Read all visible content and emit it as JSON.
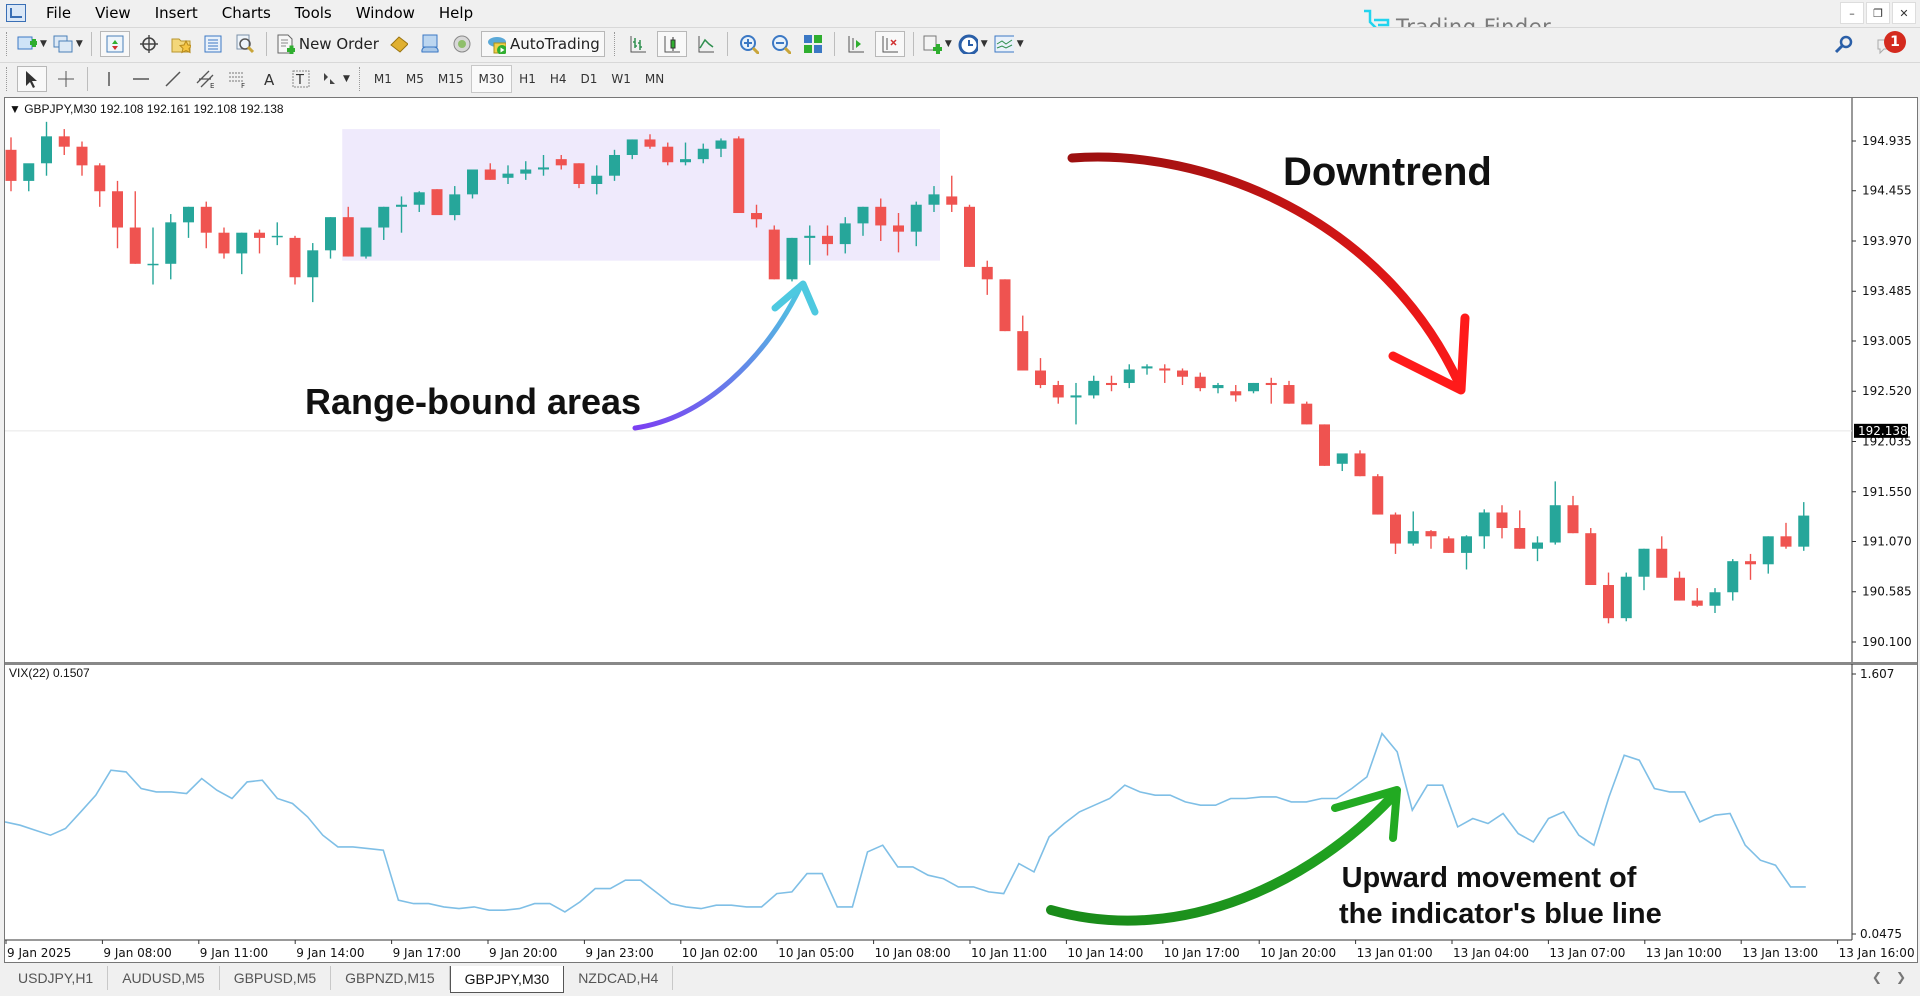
{
  "menu": [
    "File",
    "View",
    "Insert",
    "Charts",
    "Tools",
    "Window",
    "Help"
  ],
  "window_controls": {
    "minimize": "–",
    "restore": "❐",
    "close": "✕"
  },
  "brand": {
    "name": "Trading Finder",
    "color": "#1ec8e8"
  },
  "toolbar": {
    "new_order_label": "New Order",
    "autotrading_label": "AutoTrading",
    "notification_count": "1"
  },
  "timeframes": [
    "M1",
    "M5",
    "M15",
    "M30",
    "H1",
    "H4",
    "D1",
    "W1",
    "MN"
  ],
  "active_timeframe": "M30",
  "chart": {
    "symbol_header": "GBPJPY,M30  192.108 192.161 192.108 192.138",
    "current_price": "192.138",
    "indicator_label": "VIX(22) 0.1507",
    "colors": {
      "bull": "#26a69a",
      "bear": "#ef5350",
      "vix_line": "#7fbfe6",
      "range_box": "#efeafc",
      "price_tag_bg": "#000000"
    }
  },
  "annotations": {
    "range": "Range-bound areas",
    "downtrend": "Downtrend",
    "upward_line1": "Upward movement of",
    "upward_line2": "the indicator's blue line"
  },
  "tabs": [
    "USDJPY,H1",
    "AUDUSD,M5",
    "GBPUSD,M5",
    "GBPNZD,M15",
    "GBPJPY,M30",
    "NZDCAD,H4"
  ],
  "active_tab": "GBPJPY,M30",
  "chart_data": [
    {
      "type": "candlestick",
      "title": "GBPJPY,M30",
      "ylim": [
        190.0,
        195.15
      ],
      "y_ticks": [
        "194.935",
        "194.455",
        "193.970",
        "193.485",
        "193.005",
        "192.520",
        "192.035",
        "191.550",
        "191.070",
        "190.585",
        "190.100"
      ],
      "y_tick_values": [
        194.935,
        194.455,
        193.97,
        193.485,
        193.005,
        192.52,
        192.035,
        191.55,
        191.07,
        190.585,
        190.1
      ],
      "x_ticks": [
        "9 Jan 2025",
        "9 Jan 08:00",
        "9 Jan 11:00",
        "9 Jan 14:00",
        "9 Jan 17:00",
        "9 Jan 20:00",
        "9 Jan 23:00",
        "10 Jan 02:00",
        "10 Jan 05:00",
        "10 Jan 08:00",
        "10 Jan 11:00",
        "10 Jan 14:00",
        "10 Jan 17:00",
        "10 Jan 20:00",
        "13 Jan 01:00",
        "13 Jan 04:00",
        "13 Jan 07:00",
        "13 Jan 10:00",
        "13 Jan 13:00",
        "13 Jan 16:00"
      ],
      "range_box": {
        "from_index": 19,
        "to_index": 52,
        "high": 195.05,
        "low": 193.78
      },
      "ohlc": [
        [
          194.85,
          194.97,
          194.45,
          194.55
        ],
        [
          194.55,
          194.65,
          194.45,
          194.72
        ],
        [
          194.72,
          195.12,
          194.6,
          194.98
        ],
        [
          194.98,
          195.05,
          194.8,
          194.88
        ],
        [
          194.88,
          194.93,
          194.6,
          194.7
        ],
        [
          194.7,
          194.72,
          194.3,
          194.45
        ],
        [
          194.45,
          194.55,
          193.9,
          194.1
        ],
        [
          194.1,
          194.45,
          193.75,
          193.75
        ],
        [
          193.75,
          194.1,
          193.55,
          193.75
        ],
        [
          193.75,
          194.23,
          193.6,
          194.15
        ],
        [
          194.15,
          194.3,
          194.0,
          194.3
        ],
        [
          194.3,
          194.35,
          193.9,
          194.05
        ],
        [
          194.05,
          194.1,
          193.8,
          193.85
        ],
        [
          193.85,
          194.05,
          193.65,
          194.05
        ],
        [
          194.05,
          194.08,
          193.85,
          194.0
        ],
        [
          194.02,
          194.15,
          193.93,
          194.02
        ],
        [
          194.0,
          194.02,
          193.55,
          193.62
        ],
        [
          193.62,
          193.95,
          193.38,
          193.88
        ],
        [
          193.88,
          194.2,
          193.8,
          194.2
        ],
        [
          194.2,
          194.3,
          193.82,
          193.82
        ],
        [
          193.82,
          194.1,
          193.8,
          194.1
        ],
        [
          194.1,
          194.3,
          193.98,
          194.3
        ],
        [
          194.3,
          194.4,
          194.05,
          194.32
        ],
        [
          194.32,
          194.45,
          194.25,
          194.44
        ],
        [
          194.47,
          194.47,
          194.25,
          194.22
        ],
        [
          194.22,
          194.5,
          194.17,
          194.42
        ],
        [
          194.42,
          194.66,
          194.38,
          194.66
        ],
        [
          194.66,
          194.72,
          194.56,
          194.56
        ],
        [
          194.58,
          194.7,
          194.52,
          194.62
        ],
        [
          194.62,
          194.74,
          194.56,
          194.66
        ],
        [
          194.66,
          194.8,
          194.6,
          194.68
        ],
        [
          194.76,
          194.8,
          194.66,
          194.7
        ],
        [
          194.72,
          194.72,
          194.48,
          194.52
        ],
        [
          194.52,
          194.7,
          194.42,
          194.6
        ],
        [
          194.6,
          194.85,
          194.55,
          194.8
        ],
        [
          194.8,
          194.95,
          194.76,
          194.95
        ],
        [
          194.95,
          195.0,
          194.86,
          194.88
        ],
        [
          194.88,
          194.92,
          194.7,
          194.73
        ],
        [
          194.73,
          194.92,
          194.7,
          194.76
        ],
        [
          194.76,
          194.91,
          194.72,
          194.86
        ],
        [
          194.86,
          194.96,
          194.78,
          194.94
        ],
        [
          194.96,
          194.98,
          194.24,
          194.24
        ],
        [
          194.24,
          194.32,
          194.1,
          194.18
        ],
        [
          194.08,
          194.12,
          193.6,
          193.6
        ],
        [
          193.6,
          194.0,
          193.58,
          194.0
        ],
        [
          194.0,
          194.12,
          193.74,
          194.02
        ],
        [
          194.02,
          194.12,
          193.83,
          193.94
        ],
        [
          193.94,
          194.2,
          193.85,
          194.14
        ],
        [
          194.14,
          194.3,
          194.02,
          194.3
        ],
        [
          194.3,
          194.38,
          193.97,
          194.12
        ],
        [
          194.12,
          194.24,
          193.86,
          194.06
        ],
        [
          194.06,
          194.35,
          193.92,
          194.32
        ],
        [
          194.32,
          194.5,
          194.25,
          194.42
        ],
        [
          194.4,
          194.6,
          194.25,
          194.32
        ],
        [
          194.3,
          194.32,
          193.72,
          193.72
        ],
        [
          193.72,
          193.78,
          193.45,
          193.6
        ],
        [
          193.6,
          193.6,
          193.1,
          193.1
        ],
        [
          193.1,
          193.25,
          192.72,
          192.72
        ],
        [
          192.72,
          192.84,
          192.55,
          192.58
        ],
        [
          192.58,
          192.62,
          192.4,
          192.46
        ],
        [
          192.46,
          192.6,
          192.2,
          192.48
        ],
        [
          192.48,
          192.67,
          192.45,
          192.62
        ],
        [
          192.6,
          192.67,
          192.52,
          192.58
        ],
        [
          192.6,
          192.78,
          192.55,
          192.73
        ],
        [
          192.74,
          192.78,
          192.68,
          192.76
        ],
        [
          192.74,
          192.78,
          192.6,
          192.72
        ],
        [
          192.72,
          192.74,
          192.58,
          192.66
        ],
        [
          192.66,
          192.7,
          192.52,
          192.55
        ],
        [
          192.55,
          192.6,
          192.5,
          192.58
        ],
        [
          192.52,
          192.58,
          192.42,
          192.48
        ],
        [
          192.52,
          192.6,
          192.5,
          192.6
        ],
        [
          192.6,
          192.65,
          192.4,
          192.58
        ],
        [
          192.58,
          192.62,
          192.4,
          192.4
        ],
        [
          192.4,
          192.42,
          192.2,
          192.2
        ],
        [
          192.2,
          192.2,
          191.8,
          191.8
        ],
        [
          191.82,
          191.9,
          191.75,
          191.92
        ],
        [
          191.92,
          191.95,
          191.7,
          191.7
        ],
        [
          191.7,
          191.72,
          191.33,
          191.33
        ],
        [
          191.33,
          191.35,
          190.95,
          191.05
        ],
        [
          191.05,
          191.36,
          191.03,
          191.17
        ],
        [
          191.17,
          191.18,
          191.0,
          191.12
        ],
        [
          191.1,
          191.12,
          190.96,
          190.96
        ],
        [
          190.96,
          191.13,
          190.8,
          191.12
        ],
        [
          191.12,
          191.38,
          191.0,
          191.35
        ],
        [
          191.35,
          191.42,
          191.1,
          191.2
        ],
        [
          191.2,
          191.37,
          191.0,
          191.0
        ],
        [
          191.0,
          191.12,
          190.88,
          191.06
        ],
        [
          191.06,
          191.65,
          191.04,
          191.42
        ],
        [
          191.42,
          191.51,
          191.15,
          191.15
        ],
        [
          191.15,
          191.2,
          190.65,
          190.65
        ],
        [
          190.65,
          190.77,
          190.28,
          190.33
        ],
        [
          190.33,
          190.77,
          190.3,
          190.73
        ],
        [
          190.73,
          191.0,
          190.6,
          191.0
        ],
        [
          191.0,
          191.12,
          190.74,
          190.72
        ],
        [
          190.72,
          190.78,
          190.5,
          190.5
        ],
        [
          190.5,
          190.62,
          190.44,
          190.45
        ],
        [
          190.45,
          190.62,
          190.38,
          190.58
        ],
        [
          190.58,
          190.9,
          190.5,
          190.88
        ],
        [
          190.88,
          190.95,
          190.7,
          190.85
        ],
        [
          190.85,
          191.12,
          190.76,
          191.12
        ],
        [
          191.12,
          191.25,
          191.0,
          191.02
        ],
        [
          191.02,
          191.45,
          190.98,
          191.32
        ]
      ]
    },
    {
      "type": "line",
      "title": "VIX(22)",
      "series": [
        {
          "name": "VIX(22)",
          "color": "#7fbfe6"
        }
      ],
      "ylim": [
        0.0475,
        1.607
      ],
      "y_ticks": [
        "1.607",
        "0.0475"
      ],
      "last_value": 0.1507,
      "values": [
        0.72,
        0.7,
        0.67,
        0.64,
        0.68,
        0.78,
        0.88,
        1.03,
        1.02,
        0.92,
        0.9,
        0.9,
        0.89,
        0.98,
        0.91,
        0.86,
        0.96,
        0.97,
        0.86,
        0.83,
        0.75,
        0.64,
        0.57,
        0.57,
        0.56,
        0.55,
        0.25,
        0.23,
        0.23,
        0.21,
        0.2,
        0.21,
        0.19,
        0.19,
        0.2,
        0.23,
        0.23,
        0.18,
        0.24,
        0.32,
        0.32,
        0.37,
        0.37,
        0.3,
        0.23,
        0.21,
        0.2,
        0.22,
        0.22,
        0.21,
        0.21,
        0.29,
        0.3,
        0.41,
        0.41,
        0.21,
        0.21,
        0.54,
        0.58,
        0.45,
        0.45,
        0.4,
        0.38,
        0.33,
        0.33,
        0.3,
        0.29,
        0.47,
        0.42,
        0.63,
        0.71,
        0.78,
        0.82,
        0.86,
        0.94,
        0.9,
        0.88,
        0.88,
        0.84,
        0.82,
        0.82,
        0.86,
        0.86,
        0.87,
        0.87,
        0.84,
        0.84,
        0.86,
        0.86,
        0.92,
        0.99,
        1.25,
        1.14,
        0.79,
        0.94,
        0.94,
        0.69,
        0.74,
        0.71,
        0.77,
        0.65,
        0.6,
        0.74,
        0.78,
        0.64,
        0.58,
        0.87,
        1.12,
        1.09,
        0.92,
        0.9,
        0.9,
        0.72,
        0.76,
        0.77,
        0.58,
        0.49,
        0.46,
        0.33,
        0.33
      ]
    }
  ]
}
